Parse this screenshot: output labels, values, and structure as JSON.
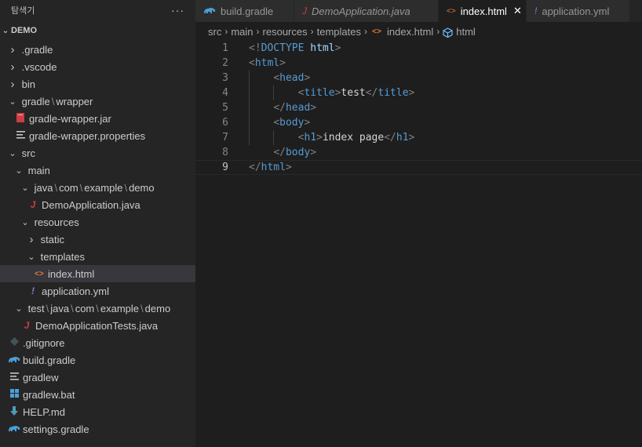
{
  "sidebar": {
    "title": "탐색기",
    "more_icon": "ellipsis-icon",
    "section": "DEMO",
    "items": [
      {
        "id": "gradle-folder",
        "label": ".gradle",
        "depth": 0,
        "kind": "folder-closed"
      },
      {
        "id": "vscode-folder",
        "label": ".vscode",
        "depth": 0,
        "kind": "folder-closed"
      },
      {
        "id": "bin-folder",
        "label": "bin",
        "depth": 0,
        "kind": "folder-closed"
      },
      {
        "id": "gradle-wrapper-folder",
        "parts": [
          "gradle",
          "wrapper"
        ],
        "depth": 0,
        "kind": "folder-open"
      },
      {
        "id": "gradle-wrapper-jar",
        "label": "gradle-wrapper.jar",
        "depth": 1,
        "kind": "file",
        "icon": "jar-icon"
      },
      {
        "id": "gradle-wrapper-properties",
        "label": "gradle-wrapper.properties",
        "depth": 1,
        "kind": "file",
        "icon": "lines-icon"
      },
      {
        "id": "src-folder",
        "label": "src",
        "depth": 0,
        "kind": "folder-open"
      },
      {
        "id": "main-folder",
        "label": "main",
        "depth": 1,
        "kind": "folder-open"
      },
      {
        "id": "java-package-folder",
        "parts": [
          "java",
          "com",
          "example",
          "demo"
        ],
        "depth": 2,
        "kind": "folder-open"
      },
      {
        "id": "demo-application-java",
        "label": "DemoApplication.java",
        "depth": 3,
        "kind": "file",
        "icon": "java-icon"
      },
      {
        "id": "resources-folder",
        "label": "resources",
        "depth": 2,
        "kind": "folder-open"
      },
      {
        "id": "static-folder",
        "label": "static",
        "depth": 3,
        "kind": "folder-closed"
      },
      {
        "id": "templates-folder",
        "label": "templates",
        "depth": 3,
        "kind": "folder-open"
      },
      {
        "id": "index-html",
        "label": "index.html",
        "depth": 4,
        "kind": "file",
        "icon": "html-icon",
        "selected": true
      },
      {
        "id": "application-yml",
        "label": "application.yml",
        "depth": 3,
        "kind": "file",
        "icon": "yaml-icon"
      },
      {
        "id": "test-package-folder",
        "parts": [
          "test",
          "java",
          "com",
          "example",
          "demo"
        ],
        "depth": 1,
        "kind": "folder-open"
      },
      {
        "id": "demo-application-tests-java",
        "label": "DemoApplicationTests.java",
        "depth": 2,
        "kind": "file",
        "icon": "java-icon"
      },
      {
        "id": "gitignore-file",
        "label": ".gitignore",
        "depth": 0,
        "kind": "file",
        "icon": "git-icon"
      },
      {
        "id": "build-gradle-file",
        "label": "build.gradle",
        "depth": 0,
        "kind": "file",
        "icon": "gradle-elephant-icon"
      },
      {
        "id": "gradlew-file",
        "label": "gradlew",
        "depth": 0,
        "kind": "file",
        "icon": "lines-icon"
      },
      {
        "id": "gradlew-bat-file",
        "label": "gradlew.bat",
        "depth": 0,
        "kind": "file",
        "icon": "windows-icon"
      },
      {
        "id": "help-md-file",
        "label": "HELP.md",
        "depth": 0,
        "kind": "file",
        "icon": "markdown-icon"
      },
      {
        "id": "settings-gradle-file",
        "label": "settings.gradle",
        "depth": 0,
        "kind": "file",
        "icon": "gradle-elephant-icon"
      }
    ]
  },
  "tabs": [
    {
      "label": "build.gradle",
      "icon": "gradle-elephant-icon",
      "active": false,
      "italic": false
    },
    {
      "label": "DemoApplication.java",
      "icon": "java-icon",
      "active": false,
      "italic": true
    },
    {
      "label": "index.html",
      "icon": "html-icon",
      "active": true,
      "italic": false,
      "close_icon": "close-icon"
    },
    {
      "label": "application.yml",
      "icon": "yaml-icon",
      "active": false,
      "italic": false
    }
  ],
  "breadcrumb": [
    "src",
    "main",
    "resources",
    "templates",
    "index.html",
    "html"
  ],
  "editor": {
    "current_line": 9,
    "lines": [
      {
        "n": "1",
        "tokens": [
          [
            "punct",
            "<!"
          ],
          [
            "doc",
            "DOCTYPE"
          ],
          [
            "text",
            " "
          ],
          [
            "kw",
            "html"
          ],
          [
            "punct",
            ">"
          ]
        ]
      },
      {
        "n": "2",
        "tokens": [
          [
            "punct",
            "<"
          ],
          [
            "tag",
            "html"
          ],
          [
            "punct",
            ">"
          ]
        ]
      },
      {
        "n": "3",
        "tokens": [
          [
            "text",
            "    "
          ],
          [
            "punct",
            "<"
          ],
          [
            "tag",
            "head"
          ],
          [
            "punct",
            ">"
          ]
        ]
      },
      {
        "n": "4",
        "tokens": [
          [
            "text",
            "        "
          ],
          [
            "punct",
            "<"
          ],
          [
            "tag",
            "title"
          ],
          [
            "punct",
            ">"
          ],
          [
            "text",
            "test"
          ],
          [
            "punct",
            "</"
          ],
          [
            "tag",
            "title"
          ],
          [
            "punct",
            ">"
          ]
        ]
      },
      {
        "n": "5",
        "tokens": [
          [
            "text",
            "    "
          ],
          [
            "punct",
            "</"
          ],
          [
            "tag",
            "head"
          ],
          [
            "punct",
            ">"
          ]
        ]
      },
      {
        "n": "6",
        "tokens": [
          [
            "text",
            "    "
          ],
          [
            "punct",
            "<"
          ],
          [
            "tag",
            "body"
          ],
          [
            "punct",
            ">"
          ]
        ]
      },
      {
        "n": "7",
        "tokens": [
          [
            "text",
            "        "
          ],
          [
            "punct",
            "<"
          ],
          [
            "tag",
            "h1"
          ],
          [
            "punct",
            ">"
          ],
          [
            "text",
            "index page"
          ],
          [
            "punct",
            "</"
          ],
          [
            "tag",
            "h1"
          ],
          [
            "punct",
            ">"
          ]
        ]
      },
      {
        "n": "8",
        "tokens": [
          [
            "text",
            "    "
          ],
          [
            "punct",
            "</"
          ],
          [
            "tag",
            "body"
          ],
          [
            "punct",
            ">"
          ]
        ]
      },
      {
        "n": "9",
        "tokens": [
          [
            "punct",
            "</"
          ],
          [
            "tag",
            "html"
          ],
          [
            "punct",
            ">"
          ]
        ]
      }
    ]
  },
  "colors": {
    "html_icon": "#e37933",
    "java_icon": "#cc3e44",
    "yaml_icon": "#a074c4",
    "gradle_icon": "#4a9fd8",
    "tag": "#569cd6"
  }
}
